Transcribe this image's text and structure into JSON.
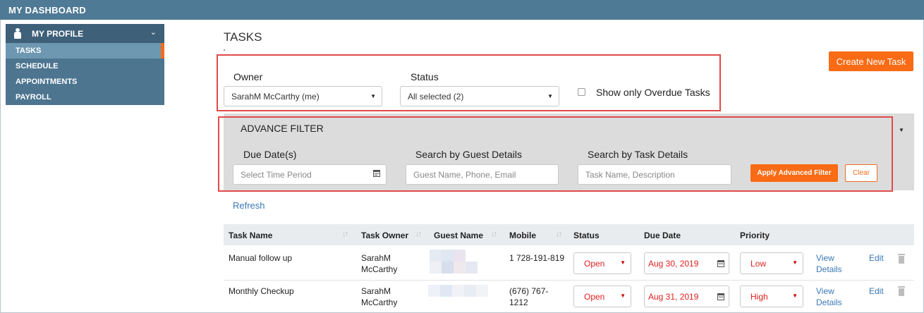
{
  "topbar": {
    "title": "MY DASHBOARD"
  },
  "sidebar": {
    "profile_label": "MY PROFILE",
    "items": [
      {
        "label": "TASKS",
        "active": true
      },
      {
        "label": "SCHEDULE",
        "active": false
      },
      {
        "label": "APPOINTMENTS",
        "active": false
      },
      {
        "label": "PAYROLL",
        "active": false
      }
    ]
  },
  "main": {
    "title": "TASKS",
    "create_button": "Create New Task",
    "filters": {
      "owner_label": "Owner",
      "owner_value": "SarahM McCarthy (me)",
      "status_label": "Status",
      "status_value": "All selected (2)",
      "overdue_label": "Show only Overdue Tasks",
      "overdue_checked": false
    },
    "advance_filter": {
      "title": "ADVANCE FILTER",
      "due_label": "Due Date(s)",
      "due_placeholder": "Select Time Period",
      "guest_label": "Search by Guest Details",
      "guest_placeholder": "Guest Name, Phone, Email",
      "task_label": "Search by Task Details",
      "task_placeholder": "Task Name, Description",
      "apply_button": "Apply Advanced Filter",
      "clear_button": "Clear"
    },
    "refresh_link": "Refresh",
    "table": {
      "columns": [
        "Task Name",
        "Task Owner",
        "Guest Name",
        "Mobile",
        "Status",
        "Due Date",
        "Priority"
      ],
      "rows": [
        {
          "task_name": "Manual follow up",
          "owner_line1": "SarahM",
          "owner_line2": "McCarthy",
          "mobile_line1": "1 728-191-819",
          "mobile_line2": "",
          "status": "Open",
          "due_date": "Aug 30, 2019",
          "priority": "Low",
          "view_line1": "View",
          "view_line2": "Details",
          "edit": "Edit"
        },
        {
          "task_name": "Monthly Checkup",
          "owner_line1": "SarahM",
          "owner_line2": "McCarthy",
          "mobile_line1": "(676) 767-",
          "mobile_line2": "1212",
          "status": "Open",
          "due_date": "Aug 31, 2019",
          "priority": "High",
          "view_line1": "View",
          "view_line2": "Details",
          "edit": "Edit"
        }
      ]
    }
  },
  "colors": {
    "topbar": "#4f7a96",
    "sidebar": "#4d7590",
    "accent": "#f96b14",
    "highlight_box": "#e04a4a",
    "link": "#3a78b5"
  }
}
